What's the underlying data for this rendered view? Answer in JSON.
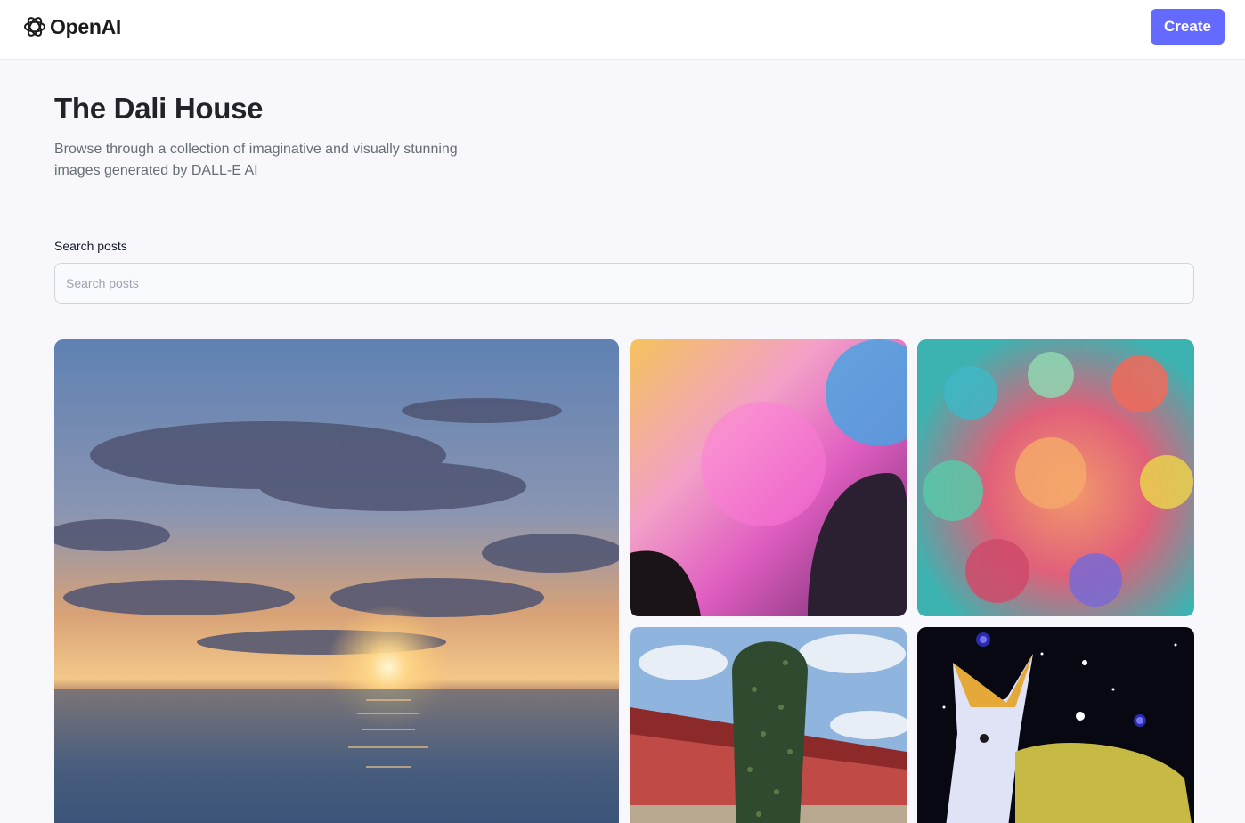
{
  "brand": {
    "name": "OpenAI",
    "accent_color": "#6469ff"
  },
  "header": {
    "create_label": "Create"
  },
  "hero": {
    "title": "The Dali House",
    "subtitle": "Browse through a collection of imaginative and visually stunning images generated by DALL-E AI"
  },
  "search": {
    "label": "Search posts",
    "placeholder": "Search posts",
    "value": ""
  },
  "gallery": {
    "cards": [
      {
        "icon": "sunset-ocean-image"
      },
      {
        "icon": "holi-color-festival-image"
      },
      {
        "icon": "colorful-crowd-painting-image"
      },
      {
        "icon": "giant-pickle-image"
      },
      {
        "icon": "cosmic-wolf-painting-image"
      }
    ]
  }
}
